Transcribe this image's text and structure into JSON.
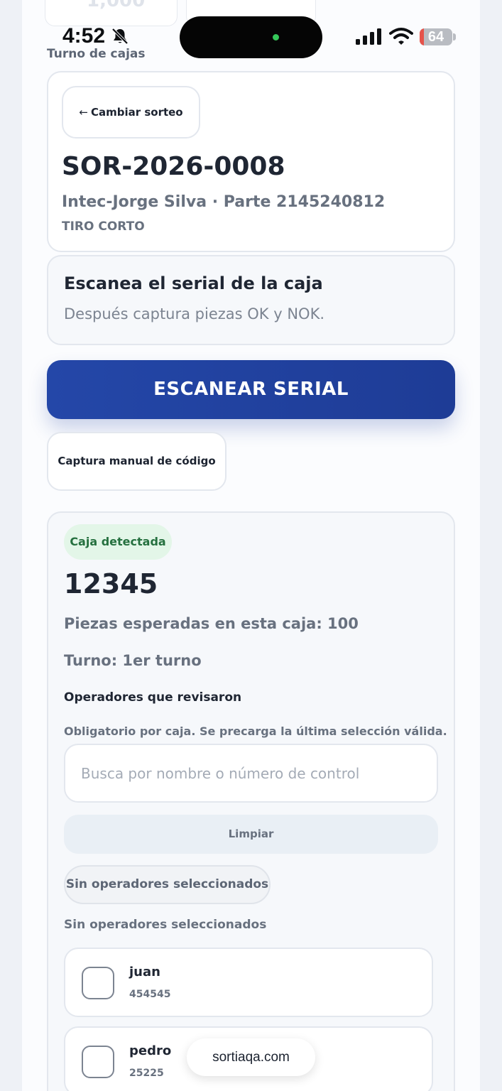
{
  "status_bar": {
    "time": "4:52",
    "battery": "64",
    "battery_level": 0.64
  },
  "ghost": {
    "value": "1,000"
  },
  "page": {
    "section_label": "Turno de cajas"
  },
  "sorteo": {
    "back_label": "Cambiar sorteo",
    "code": "SOR-2026-0008",
    "subtitle": "Intec-Jorge Silva · Parte 2145240812",
    "tag": "TIRO CORTO"
  },
  "scan": {
    "title": "Escanea el serial de la caja",
    "hint": "Después captura piezas OK y NOK.",
    "button_label": "ESCANEAR SERIAL",
    "manual_label": "Captura manual de código"
  },
  "box": {
    "badge": "Caja detectada",
    "serial": "12345",
    "expected": "Piezas esperadas en esta caja: 100",
    "turno": "Turno: 1er turno",
    "operators_title": "Operadores que revisaron",
    "operators_note": "Obligatorio por caja. Se precarga la última selección válida.",
    "search_placeholder": "Busca por nombre o número de control",
    "search_value": "",
    "clear_label": "Limpiar",
    "chip_label": "Sin operadores seleccionados",
    "none_label": "Sin operadores seleccionados",
    "operators": [
      {
        "name": "juan",
        "id": "454545"
      },
      {
        "name": "pedro",
        "id": "25225"
      }
    ]
  },
  "browser": {
    "url": "sortiaqa.com"
  },
  "colors": {
    "primary": "#2447a8",
    "success_bg": "#e3f6e8",
    "success_text": "#25703f",
    "muted": "#68717f"
  }
}
